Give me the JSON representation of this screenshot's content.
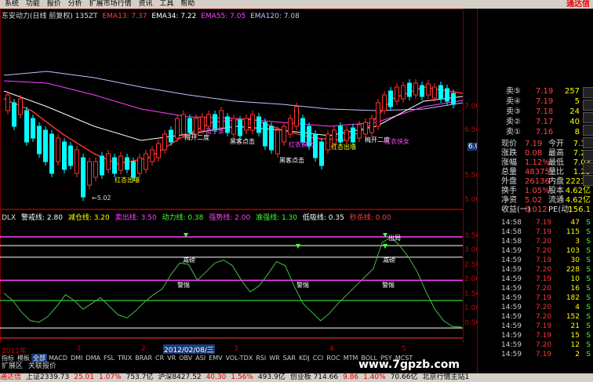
{
  "menu": {
    "items": [
      "系统",
      "功能",
      "报价",
      "分析",
      "扩展市场行情",
      "资讯",
      "工具",
      "帮助"
    ],
    "brand": "通达信"
  },
  "main_chart": {
    "title_parts": [
      {
        "text": "东安动力(日线 前复权) 135ZT",
        "color": "#dddddd"
      },
      {
        "text": "EMA13: 7.37",
        "color": "#ff4040"
      },
      {
        "text": "EMA34: 7.22",
        "color": "#ffffff"
      },
      {
        "text": "EMA55: 7.05",
        "color": "#ff40ff"
      },
      {
        "text": "EMA120: 7.08",
        "color": "#c0c0ff"
      }
    ],
    "y_ticks": [
      "7.00",
      "6.50",
      "6.05",
      "5.50",
      "5.00"
    ],
    "low_label": "5.02",
    "annotations": [
      {
        "text": "红杏出墙",
        "color": "#ffff00"
      },
      {
        "text": "梅开二度",
        "color": "#ffffff"
      },
      {
        "text": "蓝字条",
        "color": "#ff40ff"
      },
      {
        "text": "黑客点击",
        "color": "#ffffff"
      },
      {
        "text": "黑客点击",
        "color": "#ffffff"
      },
      {
        "text": "红衣侠女",
        "color": "#ff40ff"
      },
      {
        "text": "红杏出墙",
        "color": "#ffff00"
      },
      {
        "text": "梅开二度",
        "color": "#ffffff"
      },
      {
        "text": "红衣侠女",
        "color": "#ff40ff"
      }
    ]
  },
  "indicator": {
    "title_parts": [
      {
        "text": "DLX",
        "color": "#dddddd"
      },
      {
        "text": "警戒线: 2.80",
        "color": "#ffffff"
      },
      {
        "text": "减仓线: 3.20",
        "color": "#ffff00"
      },
      {
        "text": "卖出线: 3.50",
        "color": "#ff40ff"
      },
      {
        "text": "动力线: 0.38",
        "color": "#40ff40"
      },
      {
        "text": "强势线: 2.00",
        "color": "#ff40ff"
      },
      {
        "text": "准强线: 1.30",
        "color": "#40ff40"
      },
      {
        "text": "低吸线: 0.35",
        "color": "#ffffff"
      },
      {
        "text": "秒杀线: 0.00",
        "color": "#ff4040"
      }
    ],
    "y_ticks": [
      "3.50",
      "3.00",
      "2.50",
      "2.00",
      "1.50",
      "1.00",
      "0.50"
    ],
    "labels": [
      {
        "text": "减磅",
        "color": "#ffffff"
      },
      {
        "text": "警惕",
        "color": "#ffffff"
      },
      {
        "text": "警惕",
        "color": "#ffffff"
      },
      {
        "text": "警惕",
        "color": "#ffffff"
      },
      {
        "text": "减磅",
        "color": "#ffffff"
      },
      {
        "text": "出局",
        "color": "#ffffff"
      }
    ],
    "chart_data": {
      "type": "line",
      "series": [
        {
          "name": "动力线",
          "values": [
            1.55,
            1.3,
            0.9,
            0.6,
            0.55,
            0.75,
            1.1,
            1.5,
            1.3,
            1.0,
            1.2,
            1.4,
            1.1,
            0.8,
            0.7,
            0.95,
            1.25,
            1.5,
            1.7,
            2.2,
            2.6,
            2.55,
            2.0,
            2.3,
            2.6,
            2.7,
            2.5,
            2.0,
            1.6,
            1.8,
            2.2,
            2.65,
            2.5,
            1.8,
            1.2,
            0.9,
            0.6,
            0.85,
            1.2,
            1.5,
            1.8,
            2.1,
            2.4,
            3.3,
            3.5,
            3.2,
            2.8,
            2.3,
            1.6,
            1.0,
            0.6,
            0.4,
            0.38
          ]
        }
      ],
      "hlines": [
        3.5,
        3.2,
        2.8,
        2.0,
        1.3,
        0.35,
        0.0
      ],
      "ylim": [
        0,
        3.8
      ]
    }
  },
  "x_axis": {
    "labels": [
      "2011年",
      "1",
      "2",
      "2012/02/08/三",
      "3",
      "4",
      "5"
    ]
  },
  "tabs": {
    "items": [
      "指标",
      "模板",
      "全部",
      "MACD",
      "DMI",
      "DMA",
      "FSL",
      "TRIX",
      "BRAR",
      "CR",
      "VR",
      "OBV",
      "ASI",
      "EMV",
      "VOL-TDX",
      "RSI",
      "WR",
      "SAR",
      "KDJ",
      "CCI",
      "ROC",
      "MTM",
      "BOLL",
      "PSY",
      "MCST"
    ],
    "sub": [
      "扩展区",
      "关联报价"
    ]
  },
  "quote": {
    "sells": [
      {
        "label": "卖⑤",
        "price": "7.19",
        "vol": "257"
      },
      {
        "label": "卖④",
        "price": "7.19",
        "vol": "5"
      },
      {
        "label": "卖③",
        "price": "7.18",
        "vol": "24"
      },
      {
        "label": "卖②",
        "price": "7.17",
        "vol": "40"
      },
      {
        "label": "卖①",
        "price": "7.16",
        "vol": "8"
      }
    ],
    "stats": [
      {
        "l1": "现价",
        "v1": "7.19",
        "l2": "今开",
        "v2": "7.10"
      },
      {
        "l1": "涨跌",
        "v1": "0.08",
        "l2": "最高",
        "v2": "7.24"
      },
      {
        "l1": "涨幅",
        "v1": "1.12%",
        "l2": "最低",
        "v2": "7.03"
      },
      {
        "l1": "总量",
        "v1": "48375",
        "l2": "量比",
        "v2": "1.25"
      },
      {
        "l1": "外盘",
        "v1": "26136",
        "l2": "内盘",
        "v2": "22239"
      },
      {
        "l1": "换手",
        "v1": "1.05%",
        "l2": "股本",
        "v2": "4.62亿"
      },
      {
        "l1": "净资",
        "v1": "5.02",
        "l2": "流通",
        "v2": "4.62亿"
      },
      {
        "l1": "收益(一)",
        "v1": "0.012",
        "l2": "PE(动)",
        "v2": "156.1"
      }
    ],
    "ticks": [
      {
        "time": "14:58",
        "price": "7.19",
        "vol": "47",
        "side": "S"
      },
      {
        "time": "14:58",
        "price": "7.19",
        "vol": "115",
        "side": "S"
      },
      {
        "time": "14:58",
        "price": "7.20",
        "vol": "3",
        "side": "S"
      },
      {
        "time": "14:59",
        "price": "7.20",
        "vol": "103",
        "side": "S"
      },
      {
        "time": "14:59",
        "price": "7.19",
        "vol": "30",
        "side": "S"
      },
      {
        "time": "14:59",
        "price": "7.20",
        "vol": "228",
        "side": "S"
      },
      {
        "time": "14:59",
        "price": "7.19",
        "vol": "10",
        "side": "S"
      },
      {
        "time": "14:59",
        "price": "7.20",
        "vol": "16",
        "side": "S"
      },
      {
        "time": "14:59",
        "price": "7.19",
        "vol": "182",
        "side": "S"
      },
      {
        "time": "14:59",
        "price": "7.20",
        "vol": "4",
        "side": "S"
      },
      {
        "time": "14:59",
        "price": "7.20",
        "vol": "152",
        "side": "S"
      },
      {
        "time": "14:59",
        "price": "7.19",
        "vol": "21",
        "side": "S"
      },
      {
        "time": "14:59",
        "price": "7.19",
        "vol": "15",
        "side": "S"
      },
      {
        "time": "14:59",
        "price": "7.20",
        "vol": "12",
        "side": "S"
      },
      {
        "time": "14:59",
        "price": "7.19",
        "vol": "2",
        "side": "S"
      }
    ]
  },
  "status": {
    "items": [
      {
        "text": "通达信",
        "color": "#d00000"
      },
      {
        "text": "上证2339.73",
        "color": "#000000"
      },
      {
        "text": "25.01",
        "color": "#d00000"
      },
      {
        "text": "1.07%",
        "color": "#d00000"
      },
      {
        "text": "753.7亿",
        "color": "#000000"
      },
      {
        "text": "沪深8427.52",
        "color": "#000000"
      },
      {
        "text": "40.30",
        "color": "#d00000"
      },
      {
        "text": "1.56%",
        "color": "#d00000"
      },
      {
        "text": "493.9亿",
        "color": "#000000"
      },
      {
        "text": "创业板 714.66",
        "color": "#000000"
      },
      {
        "text": "9.86",
        "color": "#d00000"
      },
      {
        "text": "1.40%",
        "color": "#d00000"
      },
      {
        "text": "70.66亿",
        "color": "#000000"
      },
      {
        "text": "北京行情主站1",
        "color": "#000000"
      }
    ]
  },
  "watermark": "www.7gpzb.com"
}
